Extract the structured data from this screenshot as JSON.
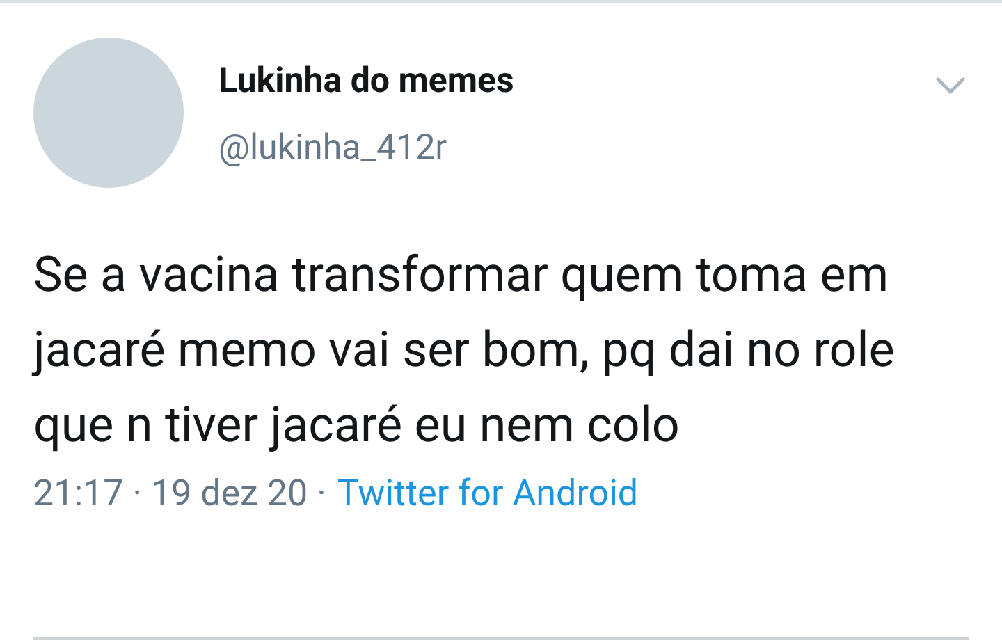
{
  "tweet": {
    "author_name": "Lukinha do memes",
    "handle": "@lukinha_412r",
    "text": "Se a vacina transformar quem toma em jacaré memo vai ser bom, pq dai no role que n tiver jacaré eu nem colo",
    "timestamp": "21:17 · 19 dez 20 ·",
    "source": "Twitter for Android"
  }
}
